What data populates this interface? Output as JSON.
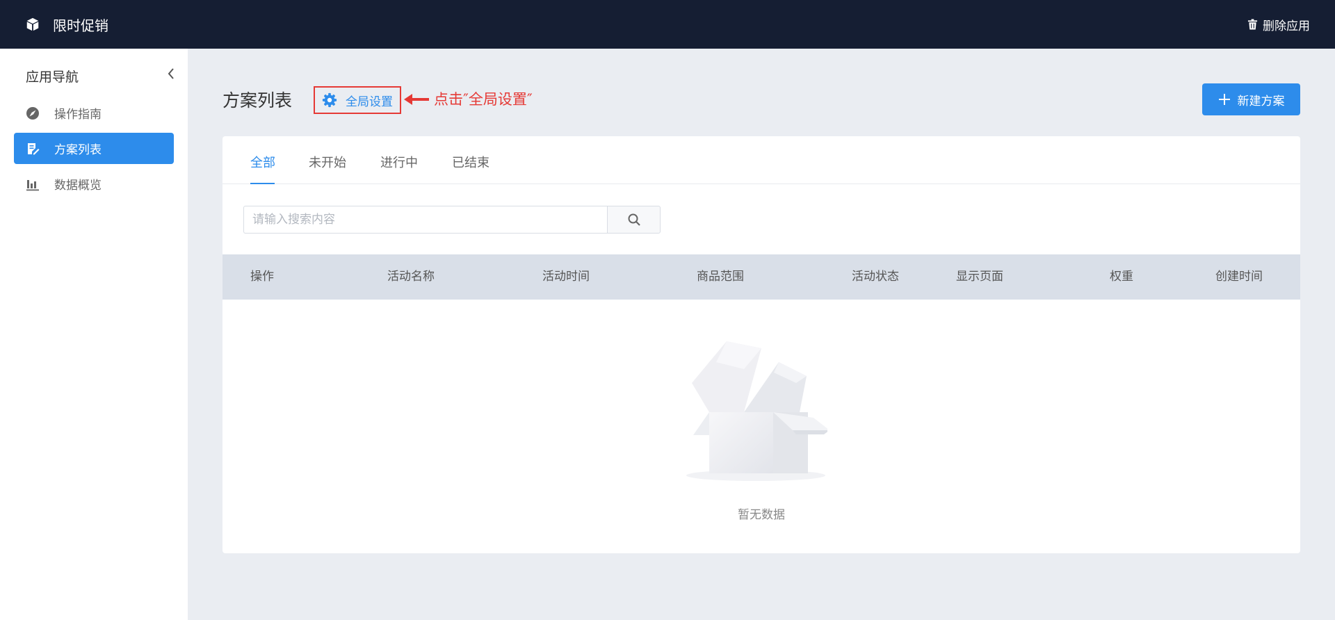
{
  "header": {
    "app_title": "限时促销",
    "delete_label": "删除应用"
  },
  "sidebar": {
    "title": "应用导航",
    "items": [
      {
        "label": "操作指南",
        "icon": "compass-icon",
        "active": false
      },
      {
        "label": "方案列表",
        "icon": "list-edit-icon",
        "active": true
      },
      {
        "label": "数据概览",
        "icon": "bar-chart-icon",
        "active": false
      }
    ]
  },
  "main": {
    "title": "方案列表",
    "global_settings_label": "全局设置",
    "annotation": "点击″全局设置″",
    "new_plan_label": "新建方案",
    "tabs": [
      {
        "label": "全部",
        "active": true
      },
      {
        "label": "未开始",
        "active": false
      },
      {
        "label": "进行中",
        "active": false
      },
      {
        "label": "已结束",
        "active": false
      }
    ],
    "search": {
      "placeholder": "请输入搜索内容",
      "value": ""
    },
    "table": {
      "columns": [
        "操作",
        "活动名称",
        "活动时间",
        "商品范围",
        "活动状态",
        "显示页面",
        "权重",
        "创建时间"
      ],
      "rows": []
    },
    "empty_text": "暂无数据"
  },
  "colors": {
    "accent": "#2d8ceb",
    "topbar": "#151e33",
    "annotation": "#e53935"
  }
}
